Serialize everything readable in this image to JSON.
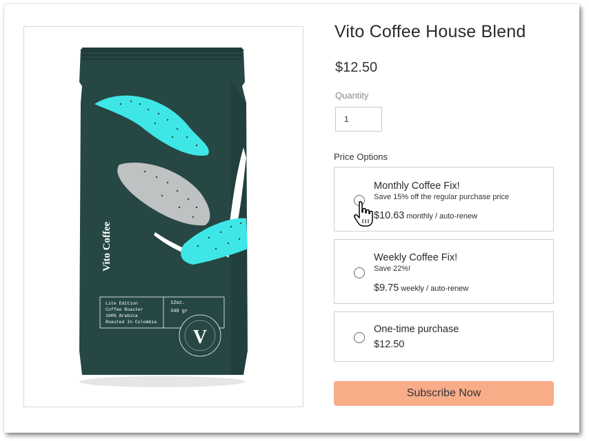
{
  "product": {
    "title": "Vito Coffee House Blend",
    "price": "$12.50",
    "image_alt": "coffee-bag-product-image",
    "bag": {
      "brand": "Vito Coffee",
      "edition": "Lite Edition",
      "line2": "Coffee Roaster",
      "line3": "100% Arabica",
      "line4": "Roasted In Colombia",
      "weight_oz": "12oz.",
      "weight_g": "340 gr",
      "emblem_letter": "V",
      "colors": {
        "bag": "#264744",
        "cyan": "#3fe6e6",
        "gray": "#bfc2c2"
      }
    }
  },
  "quantity": {
    "label": "Quantity",
    "value": "1"
  },
  "price_options": {
    "label": "Price Options",
    "options": [
      {
        "name": "Monthly Coffee Fix!",
        "description": "Save 15% off the regular purchase price",
        "amount": "$10.63",
        "frequency": "monthly / auto-renew"
      },
      {
        "name": "Weekly Coffee Fix!",
        "description": "Save 22%!",
        "amount": "$9.75",
        "frequency": "weekly / auto-renew"
      },
      {
        "name": "One-time purchase",
        "amount": "$12.50"
      }
    ]
  },
  "subscribe_button": {
    "label": "Subscribe Now",
    "color": "#f8ac88"
  },
  "icons": {
    "cursor": "hand-pointer-icon"
  }
}
